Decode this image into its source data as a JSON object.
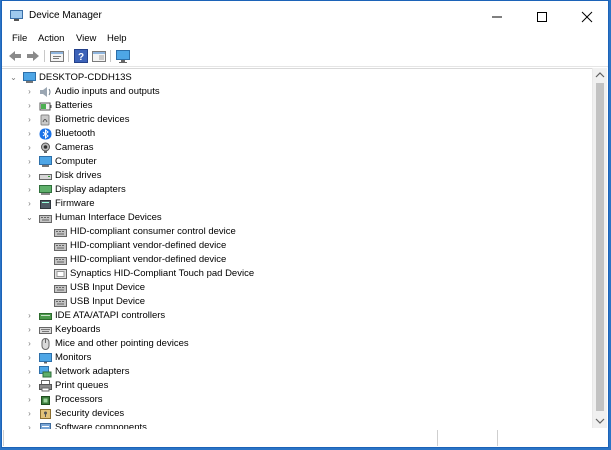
{
  "window": {
    "title": "Device Manager"
  },
  "menu": [
    "File",
    "Action",
    "View",
    "Help"
  ],
  "toolbar": [
    "back-icon",
    "forward-icon",
    "properties-icon",
    "help-icon",
    "scan-changes-icon",
    "monitor-icon"
  ],
  "tree": {
    "root": "DESKTOP-CDDH13S",
    "categories": [
      {
        "label": "Audio inputs and outputs",
        "icon": "speaker-icon"
      },
      {
        "label": "Batteries",
        "icon": "battery-icon"
      },
      {
        "label": "Biometric devices",
        "icon": "biometric-icon"
      },
      {
        "label": "Bluetooth",
        "icon": "bluetooth-icon"
      },
      {
        "label": "Cameras",
        "icon": "camera-icon"
      },
      {
        "label": "Computer",
        "icon": "computer-icon"
      },
      {
        "label": "Disk drives",
        "icon": "disk-icon"
      },
      {
        "label": "Display adapters",
        "icon": "display-adapter-icon"
      },
      {
        "label": "Firmware",
        "icon": "firmware-icon"
      },
      {
        "label": "Human Interface Devices",
        "icon": "hid-icon",
        "expanded": true
      },
      {
        "label": "IDE ATA/ATAPI controllers",
        "icon": "ide-icon"
      },
      {
        "label": "Keyboards",
        "icon": "keyboard-icon"
      },
      {
        "label": "Mice and other pointing devices",
        "icon": "mouse-icon"
      },
      {
        "label": "Monitors",
        "icon": "monitor-icon"
      },
      {
        "label": "Network adapters",
        "icon": "network-icon"
      },
      {
        "label": "Print queues",
        "icon": "printer-icon"
      },
      {
        "label": "Processors",
        "icon": "processor-icon"
      },
      {
        "label": "Security devices",
        "icon": "security-icon"
      },
      {
        "label": "Software components",
        "icon": "software-icon"
      }
    ],
    "hid_children": [
      "HID-compliant consumer control device",
      "HID-compliant vendor-defined device",
      "HID-compliant vendor-defined device",
      "Synaptics HID-Compliant Touch pad Device",
      "USB Input Device",
      "USB Input Device"
    ]
  },
  "colors": {
    "accent": "#0078d7",
    "border": "#1c63b8"
  }
}
